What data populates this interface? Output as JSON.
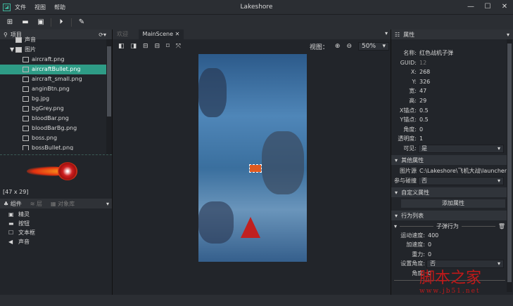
{
  "app": {
    "title": "Lakeshore",
    "menu": [
      "文件",
      "视图",
      "帮助"
    ]
  },
  "toolbar": [
    "new-project",
    "open",
    "save",
    "run",
    "publish"
  ],
  "project_panel": {
    "title": "项目",
    "items": [
      {
        "label": "声音",
        "type": "folder"
      },
      {
        "label": "图片",
        "type": "folder-open"
      },
      {
        "label": "aircraft.png"
      },
      {
        "label": "aircraftBullet.png",
        "selected": true
      },
      {
        "label": "aircraft_small.png"
      },
      {
        "label": "anginBtn.png"
      },
      {
        "label": "bg.jpg"
      },
      {
        "label": "bgGrey.png"
      },
      {
        "label": "bloodBar.png"
      },
      {
        "label": "bloodBarBg.png"
      },
      {
        "label": "boss.png"
      },
      {
        "label": "bossBullet.png"
      }
    ],
    "preview_size": "[47 x 29]"
  },
  "components_panel": {
    "tabs": [
      "组件",
      "层",
      "对象库"
    ],
    "items": [
      "精灵",
      "按钮",
      "文本框",
      "声音"
    ]
  },
  "editor": {
    "tabs": [
      "欢迎",
      "MainScene"
    ],
    "view_label": "视图：",
    "zoom": "50%"
  },
  "properties": {
    "title": "属性",
    "rows": [
      {
        "k": "名称:",
        "v": "红色战机子弹"
      },
      {
        "k": "GUID:",
        "v": "12"
      },
      {
        "k": "X:",
        "v": "268"
      },
      {
        "k": "Y:",
        "v": "326"
      },
      {
        "k": "宽:",
        "v": "47"
      },
      {
        "k": "高:",
        "v": "29"
      },
      {
        "k": "X锚点:",
        "v": "0.5"
      },
      {
        "k": "Y锚点:",
        "v": "0.5"
      },
      {
        "k": "角度:",
        "v": "0"
      },
      {
        "k": "透明度:",
        "v": "1"
      }
    ],
    "visible": {
      "k": "可见:",
      "v": "是"
    },
    "other_section": "其他属性",
    "image_src": {
      "k": "图片源",
      "v": "C:\\Lakeshore\\飞机大战\\launcher\\res"
    },
    "collision": {
      "k": "参与碰撞",
      "v": "否"
    },
    "custom_section": "自定义属性",
    "add_attr": "添加属性",
    "behavior_section": "行为列表",
    "behavior": {
      "name": "子弹行为",
      "rows": [
        {
          "k": "运动速度:",
          "v": "400"
        },
        {
          "k": "加速度:",
          "v": "0"
        },
        {
          "k": "重力:",
          "v": "0"
        }
      ],
      "set_angle": {
        "k": "设置角度:",
        "v": "否"
      },
      "angle": {
        "k": "角度:",
        "v": "0"
      }
    }
  },
  "watermark": {
    "text": "脚本之家",
    "url": "www.jb51.net"
  }
}
